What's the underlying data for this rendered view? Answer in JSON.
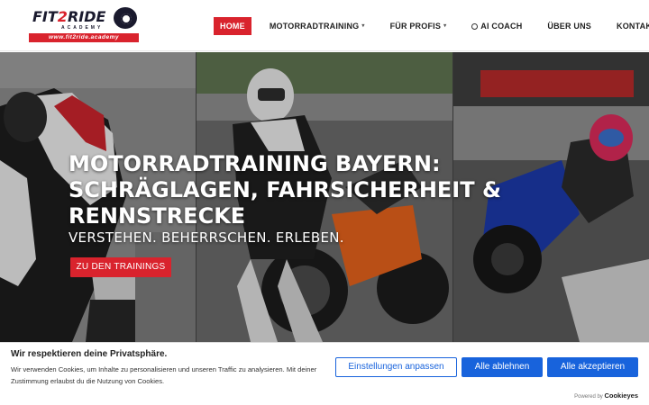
{
  "header": {
    "logo": {
      "title_part1": "FIT",
      "title_part2": "2",
      "title_part3": "RIDE",
      "tagline": "ACADEMY",
      "url": "www.fit2ride.academy"
    },
    "nav": [
      {
        "label": "HOME",
        "active": true,
        "icon": ""
      },
      {
        "label": "MOTORRADTRAINING",
        "dropdown": true,
        "icon": "chevron-down-icon"
      },
      {
        "label": "FÜR PROFIS",
        "dropdown": true,
        "icon": "chevron-down-icon"
      },
      {
        "label": "AI COACH",
        "icon": "ai-coach-icon"
      },
      {
        "label": "ÜBER UNS"
      },
      {
        "label": "KONTAKT"
      }
    ],
    "accent_color": "#d9232d"
  },
  "hero": {
    "title": "MOTORRADTRAINING BAYERN: SCHRÄGLAGEN, FAHRSICHERHEIT & RENNSTRECKE",
    "subtitle": "VERSTEHEN. BEHERRSCHEN. ERLEBEN.",
    "cta_label": "ZU DEN TRAININGS"
  },
  "cookie_banner": {
    "title": "Wir respektieren deine Privatsphäre.",
    "text": "Wir verwenden Cookies, um Inhalte zu personalisieren und unseren Traffic zu analysieren. Mit deiner Zustimmung erlaubst du die Nutzung von Cookies.",
    "settings_label": "Einstellungen anpassen",
    "reject_label": "Alle ablehnen",
    "accept_label": "Alle akzeptieren",
    "powered_by": "Powered by",
    "powered_brand": "Cookieyes",
    "button_color": "#1863dc"
  }
}
